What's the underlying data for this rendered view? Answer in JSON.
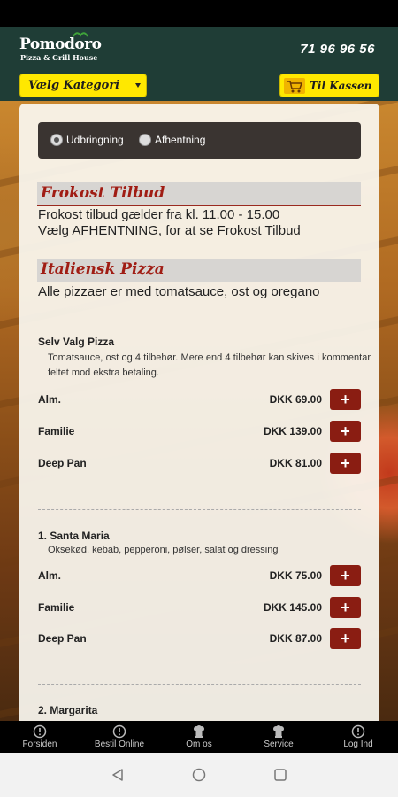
{
  "header": {
    "logo_main": "Pomodoro",
    "logo_sub": "Pizza & Grill House",
    "phone": "71 96 96 56",
    "category_select": "Vælg Kategori",
    "cart_button": "Til Kassen",
    "cart_icon": "shopping-cart-icon"
  },
  "delivery": {
    "options": [
      {
        "label": "Udbringning",
        "checked": true
      },
      {
        "label": "Afhentning",
        "checked": false
      }
    ]
  },
  "sections": {
    "lunch": {
      "title": "Frokost Tilbud",
      "desc_line1": "Frokost tilbud gælder fra kl. 11.00 - 15.00",
      "desc_line2": "Vælg AFHENTNING, for at se Frokost Tilbud"
    },
    "pizza": {
      "title": "Italiensk Pizza",
      "desc": "Alle pizzaer er med tomatsauce, ost og oregano"
    }
  },
  "items": [
    {
      "name": "Selv Valg Pizza",
      "desc": "Tomatsauce, ost og 4 tilbehør. Mere end 4 tilbehør kan skives i kommentar feltet mod ekstra betaling.",
      "prices": [
        {
          "size": "Alm.",
          "price": "DKK 69.00"
        },
        {
          "size": "Familie",
          "price": "DKK 139.00"
        },
        {
          "size": "Deep Pan",
          "price": "DKK 81.00"
        }
      ]
    },
    {
      "name": "1. Santa Maria",
      "desc": "Oksekød, kebab, pepperoni, pølser, salat og dressing",
      "prices": [
        {
          "size": "Alm.",
          "price": "DKK 75.00"
        },
        {
          "size": "Familie",
          "price": "DKK 145.00"
        },
        {
          "size": "Deep Pan",
          "price": "DKK 87.00"
        }
      ]
    },
    {
      "name": "2. Margarita"
    }
  ],
  "add_button_label": "+",
  "bottom_nav": [
    {
      "label": "Forsiden",
      "icon": "info-circle-icon"
    },
    {
      "label": "Bestil Online",
      "icon": "info-circle-icon"
    },
    {
      "label": "Om os",
      "icon": "chef-icon"
    },
    {
      "label": "Service",
      "icon": "chef-icon"
    },
    {
      "label": "Log Ind",
      "icon": "info-circle-icon"
    }
  ],
  "colors": {
    "header_bg": "#1f3d36",
    "accent_yellow": "#ffe800",
    "section_title_red": "#a01d14",
    "add_button_red": "#8a1d12"
  }
}
